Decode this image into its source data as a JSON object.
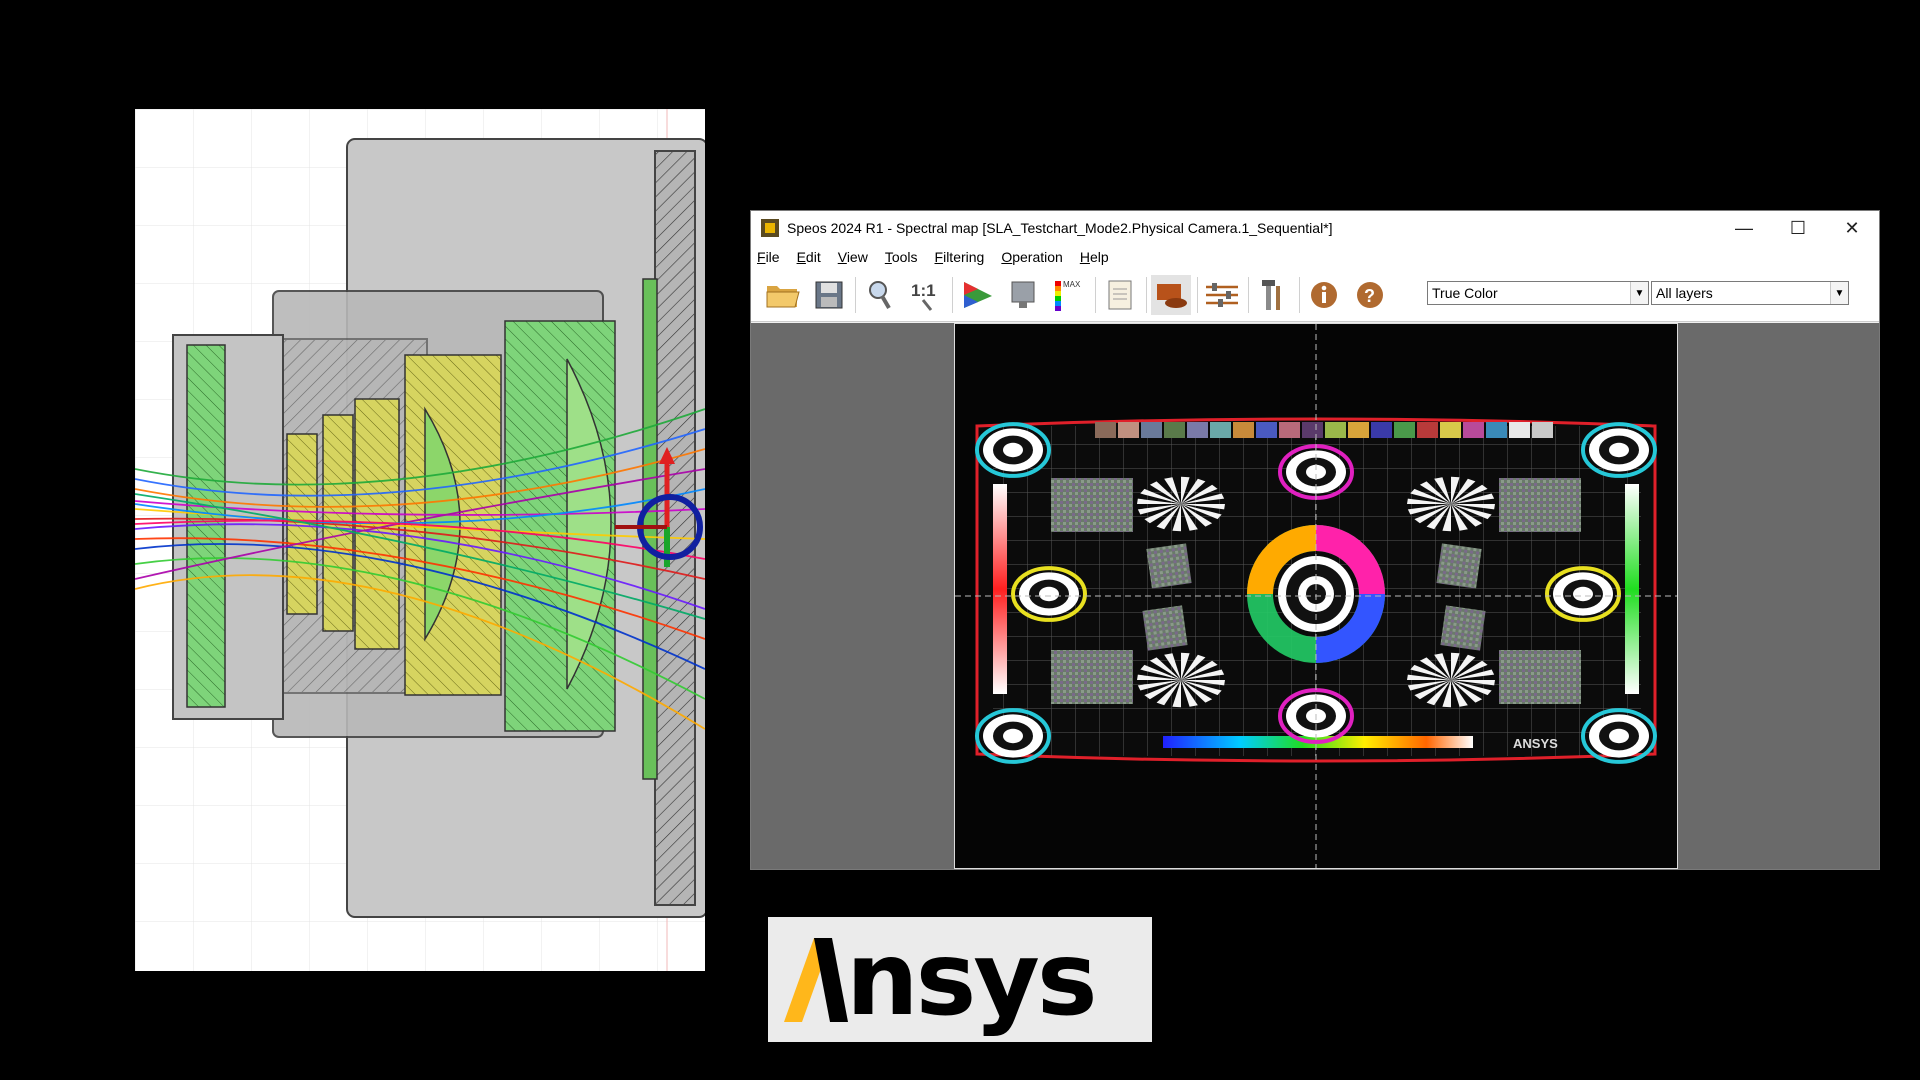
{
  "window": {
    "title": "Speos 2024 R1 - Spectral map [SLA_Testchart_Mode2.Physical Camera.1_Sequential*]",
    "controls": {
      "minimize": "—",
      "maximize": "☐",
      "close": "✕"
    }
  },
  "menu": [
    {
      "label": "File",
      "key": "F",
      "rest": "ile"
    },
    {
      "label": "Edit",
      "key": "E",
      "rest": "dit"
    },
    {
      "label": "View",
      "key": "V",
      "rest": "iew"
    },
    {
      "label": "Tools",
      "key": "T",
      "rest": "ools"
    },
    {
      "label": "Filtering",
      "key": "F",
      "rest": "iltering"
    },
    {
      "label": "Operation",
      "key": "O",
      "rest": "peration"
    },
    {
      "label": "Help",
      "key": "H",
      "rest": "elp"
    }
  ],
  "toolbar": {
    "icons": [
      "open-folder-icon",
      "save-icon",
      "zoom-icon",
      "actual-size-icon",
      "color-triangle-icon",
      "monitor-icon",
      "max-scale-icon",
      "report-icon",
      "surface-icon",
      "settings-sliders-icon",
      "tools-icon",
      "info-icon",
      "help-icon"
    ],
    "actual_size_label": "1:1",
    "max_label": "MAX",
    "color_mode": "True Color",
    "layers": "All layers"
  },
  "testchart": {
    "brand": "ANSYS"
  },
  "logo": {
    "text": "nsys",
    "accent_color": "#ffb71b"
  },
  "colors": {
    "background": "#000000",
    "viewport": "#6a6a6a",
    "chart_border": "#e0202a"
  }
}
